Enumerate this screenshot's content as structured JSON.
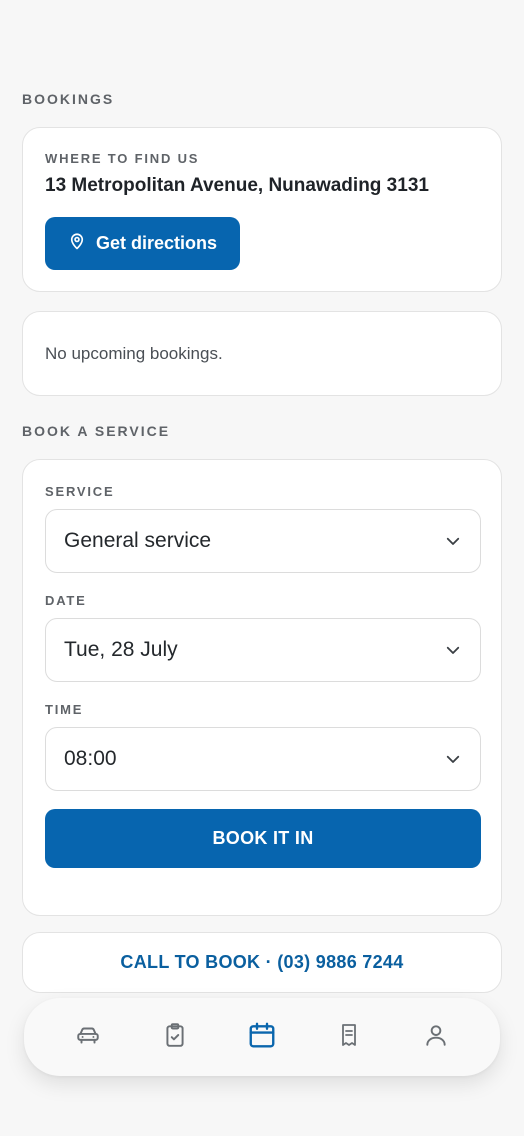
{
  "bookings_section": {
    "label": "BOOKINGS"
  },
  "location": {
    "label": "WHERE TO FIND US",
    "address": "13 Metropolitan Avenue, Nunawading 3131",
    "directions_label": "Get directions"
  },
  "upcoming": {
    "empty_text": "No upcoming bookings."
  },
  "book_section": {
    "label": "BOOK A SERVICE"
  },
  "form": {
    "service_label": "SERVICE",
    "service_value": "General service",
    "date_label": "DATE",
    "date_value": "Tue, 28 July",
    "time_label": "TIME",
    "time_value": "08:00",
    "submit_label": "BOOK IT IN"
  },
  "call": {
    "label": "CALL TO BOOK · (03) 9886 7244"
  },
  "tabbar": {
    "items": [
      {
        "icon": "car-icon"
      },
      {
        "icon": "clipboard-check-icon"
      },
      {
        "icon": "calendar-icon",
        "active": true
      },
      {
        "icon": "receipt-icon"
      },
      {
        "icon": "user-icon"
      }
    ]
  },
  "colors": {
    "accent": "#0765af",
    "call_text": "#0a5f9f",
    "tab_inactive": "#6b7075",
    "tab_active": "#0a66ad",
    "background": "#f7f7f7"
  }
}
